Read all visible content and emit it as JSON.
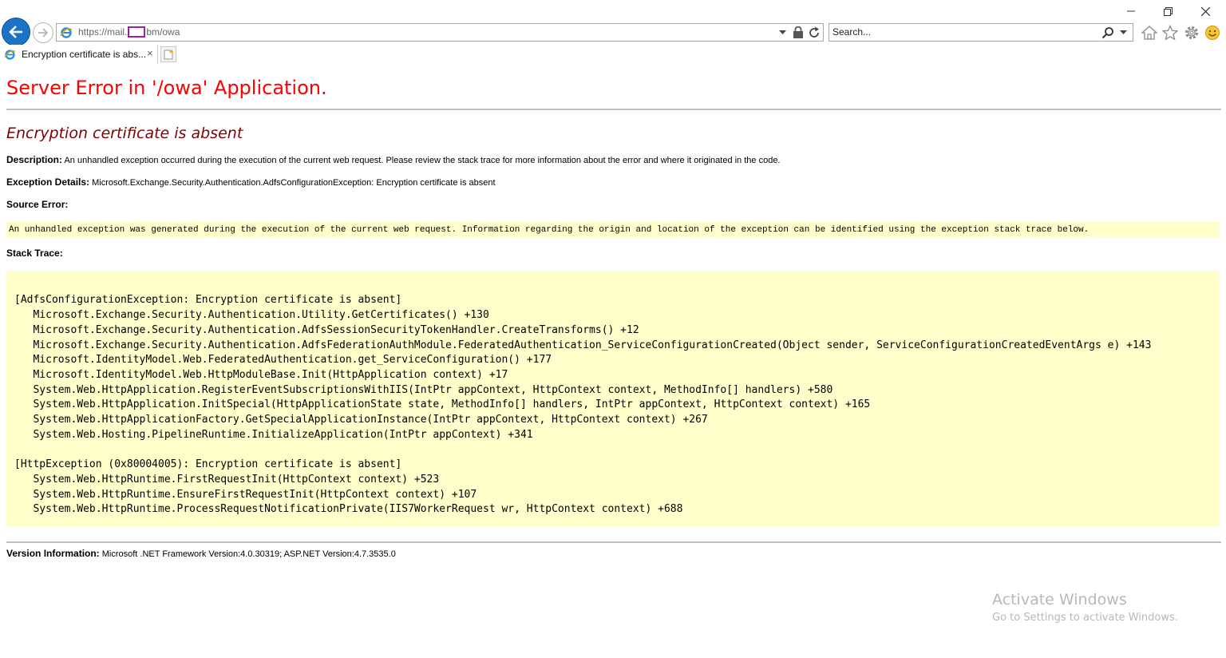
{
  "window": {
    "minimize_label": "minimize",
    "restore_label": "restore",
    "close_label": "close"
  },
  "toolbar": {
    "url_prefix": "https://mail.",
    "url_suffix": "bm/owa",
    "search_placeholder": "Search...",
    "icons": [
      "back-arrow-icon",
      "forward-arrow-icon",
      "ie-logo-icon",
      "dropdown-icon",
      "lock-icon",
      "refresh-icon",
      "search-icon",
      "home-icon",
      "favorites-star-icon",
      "gear-icon",
      "smiley-feedback-icon"
    ]
  },
  "tabs": [
    {
      "title": "Encryption certificate is abs...",
      "close": "×"
    }
  ],
  "page": {
    "title": "Server Error in '/owa' Application.",
    "subtitle": "Encryption certificate is absent",
    "description_label": "Description:",
    "description_text": "An unhandled exception occurred during the execution of the current web request. Please review the stack trace for more information about the error and where it originated in the code.",
    "exception_label": "Exception Details:",
    "exception_text": "Microsoft.Exchange.Security.Authentication.AdfsConfigurationException: Encryption certificate is absent",
    "source_error_label": "Source Error:",
    "source_error_text": "An unhandled exception was generated during the execution of the current web request. Information regarding the origin and location of the exception can be identified using the exception stack trace below.",
    "stack_trace_label": "Stack Trace:",
    "stack_lines": [
      "[AdfsConfigurationException: Encryption certificate is absent]",
      "   Microsoft.Exchange.Security.Authentication.Utility.GetCertificates() +130",
      "   Microsoft.Exchange.Security.Authentication.AdfsSessionSecurityTokenHandler.CreateTransforms() +12",
      "   Microsoft.Exchange.Security.Authentication.AdfsFederationAuthModule.FederatedAuthentication_ServiceConfigurationCreated(Object sender, ServiceConfigurationCreatedEventArgs e) +143",
      "   Microsoft.IdentityModel.Web.FederatedAuthentication.get_ServiceConfiguration() +177",
      "   Microsoft.IdentityModel.Web.HttpModuleBase.Init(HttpApplication context) +17",
      "   System.Web.HttpApplication.RegisterEventSubscriptionsWithIIS(IntPtr appContext, HttpContext context, MethodInfo[] handlers) +580",
      "   System.Web.HttpApplication.InitSpecial(HttpApplicationState state, MethodInfo[] handlers, IntPtr appContext, HttpContext context) +165",
      "   System.Web.HttpApplicationFactory.GetSpecialApplicationInstance(IntPtr appContext, HttpContext context) +267",
      "   System.Web.Hosting.PipelineRuntime.InitializeApplication(IntPtr appContext) +341",
      "",
      "[HttpException (0x80004005): Encryption certificate is absent]",
      "   System.Web.HttpRuntime.FirstRequestInit(HttpContext context) +523",
      "   System.Web.HttpRuntime.EnsureFirstRequestInit(HttpContext context) +107",
      "   System.Web.HttpRuntime.ProcessRequestNotificationPrivate(IIS7WorkerRequest wr, HttpContext context) +688"
    ],
    "version_label": "Version Information:",
    "version_text": "Microsoft .NET Framework Version:4.0.30319; ASP.NET Version:4.7.3535.0"
  },
  "watermark": {
    "line1": "Activate Windows",
    "line2": "Go to Settings to activate Windows."
  },
  "colors": {
    "title_red": "#ff0000",
    "subtitle_maroon": "#800000",
    "code_bg": "#ffffcc",
    "back_button_blue": "#1a73c7"
  }
}
